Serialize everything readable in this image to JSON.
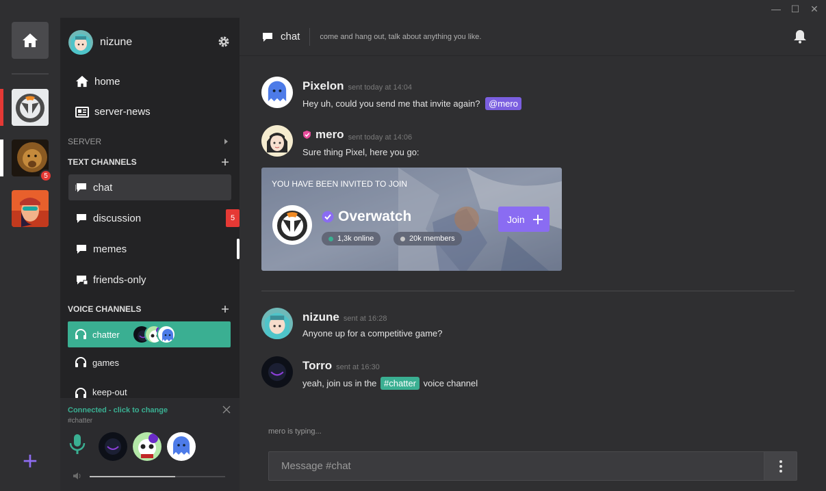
{
  "window": {
    "minimize": "—",
    "maximize": "☐",
    "close": "✕"
  },
  "rail": {
    "servers": [
      {
        "name": "overwatch",
        "mark_color": "#e53935"
      },
      {
        "name": "lion",
        "mark_color": "#ffffff",
        "badge": "5"
      },
      {
        "name": "girl"
      }
    ],
    "add": "+"
  },
  "user": {
    "name": "nizune"
  },
  "nav": {
    "home": "home",
    "server_news": "server-news"
  },
  "sections": {
    "server": "SERVER",
    "text": "TEXT CHANNELS",
    "voice": "VOICE CHANNELS"
  },
  "text_channels": [
    {
      "name": "chat"
    },
    {
      "name": "discussion",
      "badge": "5"
    },
    {
      "name": "memes"
    },
    {
      "name": "friends-only"
    }
  ],
  "voice_channels": [
    {
      "name": "chatter"
    },
    {
      "name": "games"
    },
    {
      "name": "keep-out"
    }
  ],
  "connection": {
    "status": "Connected - click to change",
    "channel": "#chatter",
    "volume": 0.63
  },
  "header": {
    "channel": "chat",
    "topic": "come and hang out, talk about anything you like."
  },
  "messages": [
    {
      "author": "Pixelon",
      "time": "sent today at 14:04",
      "text": "Hey uh, could you send me that invite again?",
      "mention": "@mero"
    },
    {
      "author": "mero",
      "time": "sent today at 14:06",
      "text": "Sure thing Pixel, here you go:"
    },
    {
      "author": "nizune",
      "time": "sent at 16:28",
      "text": "Anyone up for a competitive game?"
    },
    {
      "author": "Torro",
      "time": "sent at 16:30",
      "text_before": "yeah, join us in the",
      "channel_mention": "#chatter",
      "text_after": "voice channel"
    }
  ],
  "invite": {
    "label": "YOU HAVE BEEN INVITED TO JOIN",
    "server": "Overwatch",
    "online": "1,3k online",
    "members": "20k members",
    "join": "Join",
    "online_color": "#3aaf92",
    "members_color": "#c8c8c8"
  },
  "typing": "mero is typing...",
  "composer": {
    "placeholder": "Message #chat"
  },
  "colors": {
    "accent": "#8a6cf2",
    "voice": "#3aaf92",
    "alert": "#e53935"
  }
}
